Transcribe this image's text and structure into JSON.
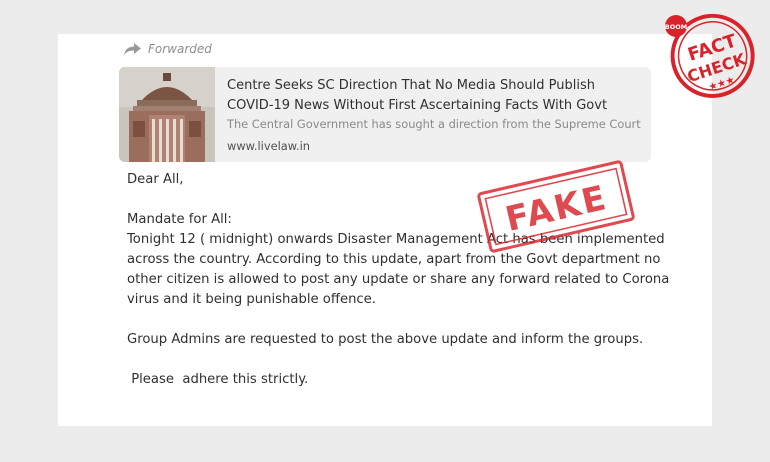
{
  "forwarded_label": "Forwarded",
  "link_preview": {
    "title": "Centre Seeks SC Direction That No Media Should Publish COVID-19 News Without First Ascertaining Facts With Govt",
    "description": "The Central Government has sought a direction from the Supreme Court",
    "domain": "www.livelaw.in"
  },
  "message": {
    "greeting": "Dear All,",
    "mandate_heading": "Mandate for All:",
    "body": "Tonight  12 ( midnight) onwards Disaster Management Act has been implemented across the country. According to this update, apart from the Govt department no other citizen is allowed to post any update or share any forward related to Corona virus and it being punishable offence.",
    "admins": "Group Admins are requested to post the above update and inform the groups.",
    "closing": " Please  adhere this strictly."
  },
  "stamps": {
    "fake": "FAKE",
    "badge_top": "BOOM",
    "badge_line1": "FACT",
    "badge_line2": "CHECK",
    "stamp_color": "#d8232a"
  }
}
